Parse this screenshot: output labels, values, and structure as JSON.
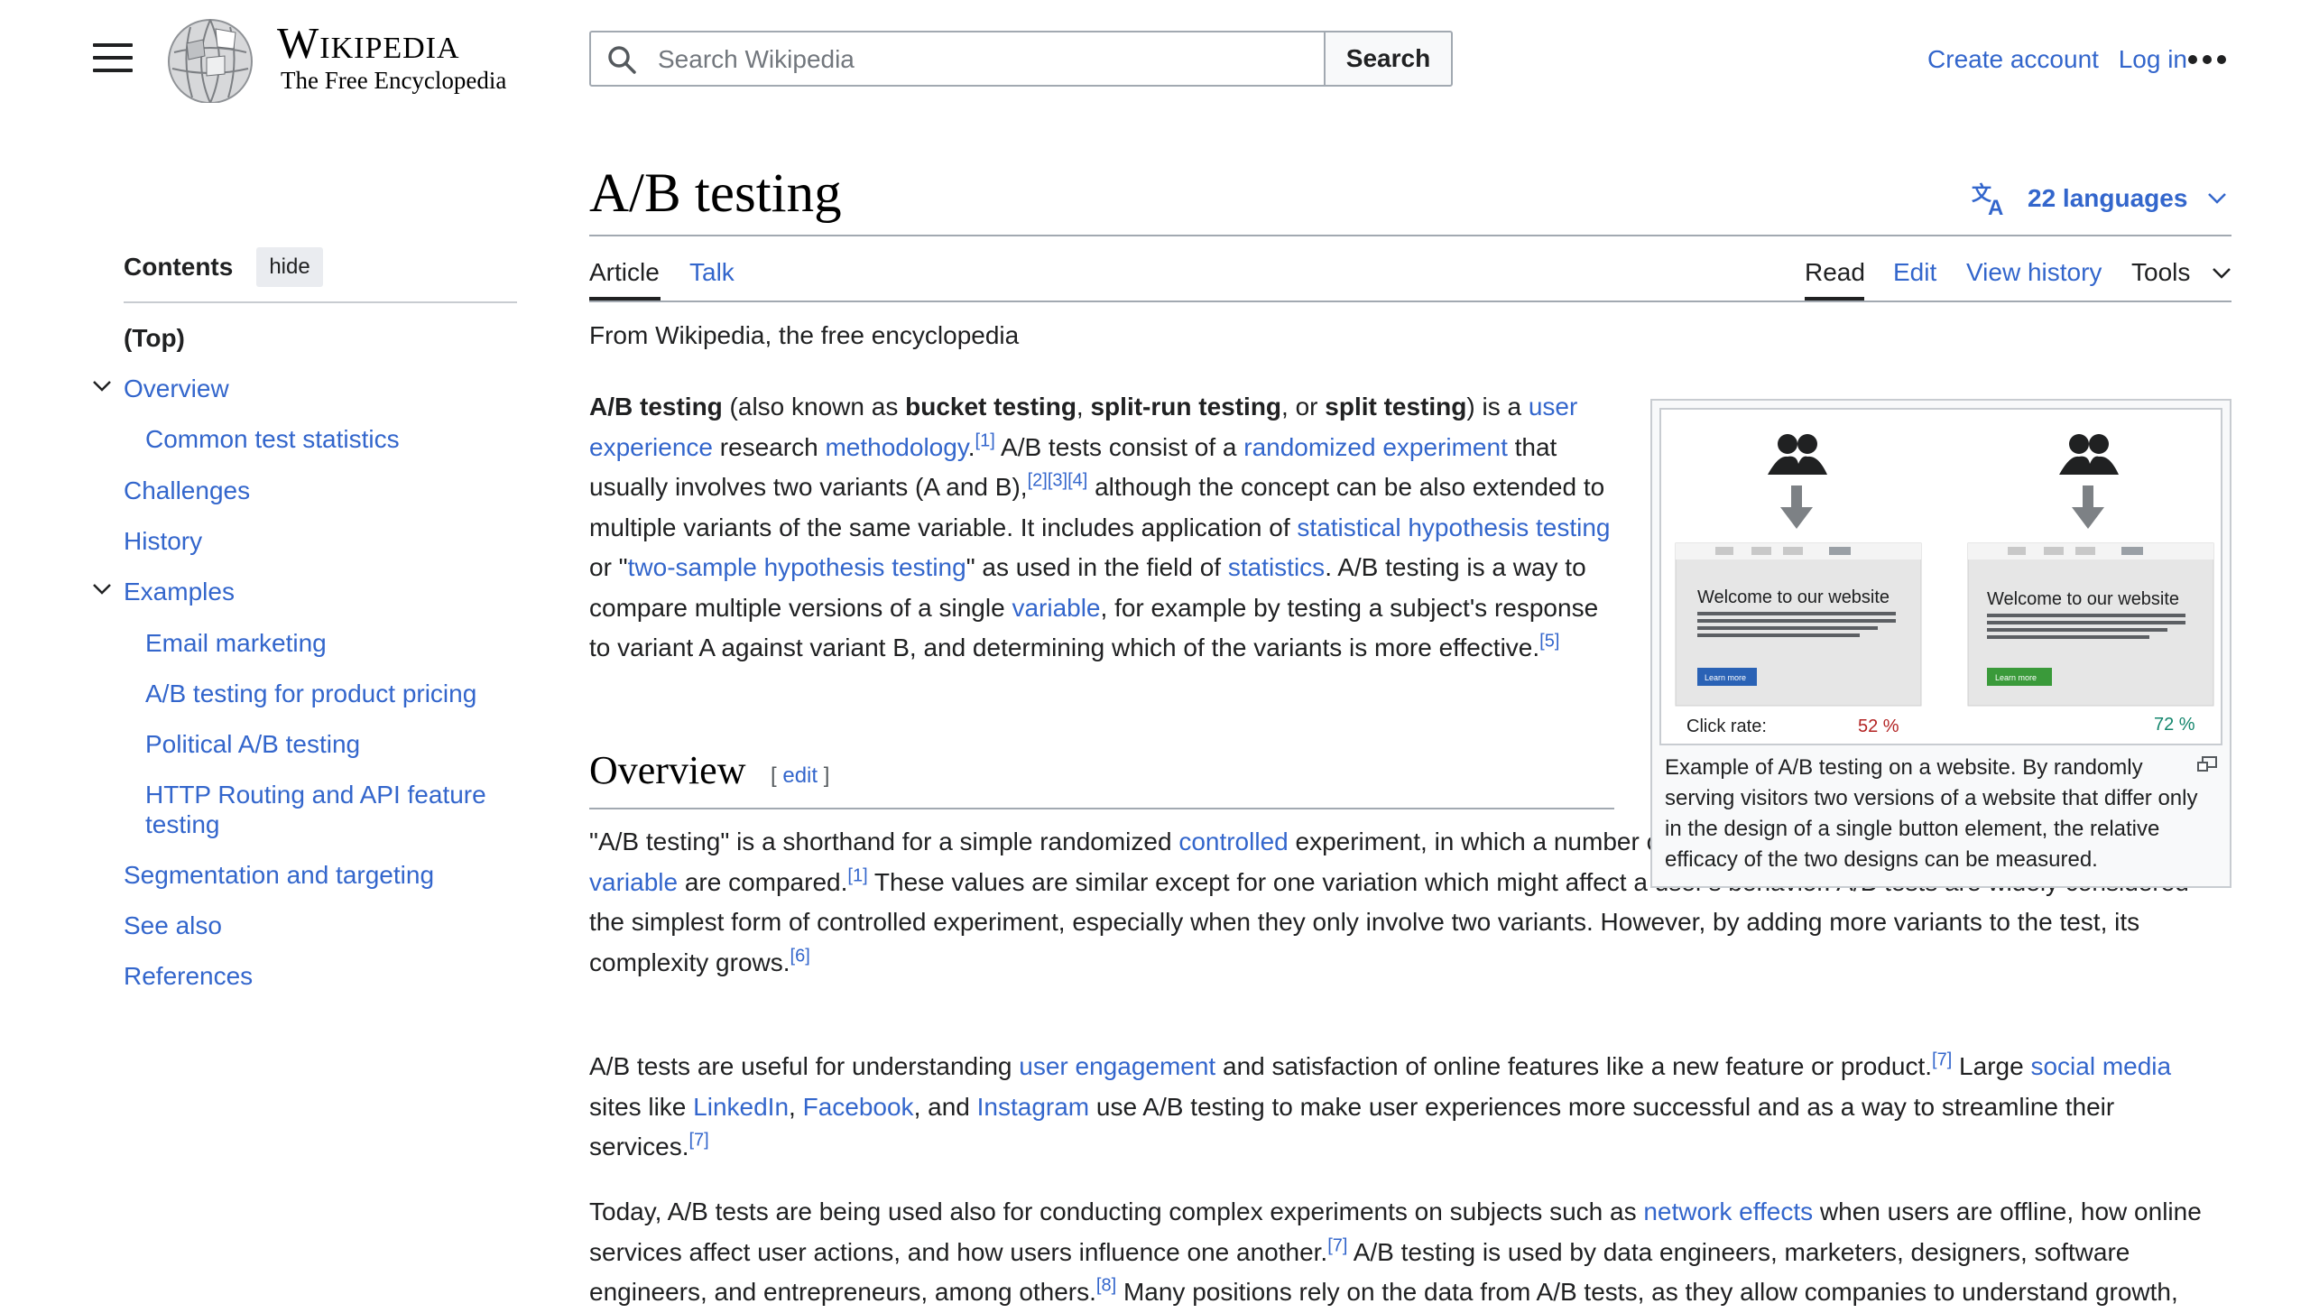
{
  "header": {
    "logo_wordmark": "Wikipedia",
    "logo_tagline": "The Free Encyclopedia",
    "search_placeholder": "Search Wikipedia",
    "search_button": "Search",
    "create_account": "Create account",
    "log_in": "Log in"
  },
  "toc": {
    "title": "Contents",
    "hide_label": "hide",
    "items": [
      {
        "label": "(Top)"
      },
      {
        "label": "Overview"
      },
      {
        "label": "Common test statistics"
      },
      {
        "label": "Challenges"
      },
      {
        "label": "History"
      },
      {
        "label": "Examples"
      },
      {
        "label": "Email marketing"
      },
      {
        "label": "A/B testing for product pricing"
      },
      {
        "label": "Political A/B testing"
      },
      {
        "label": "HTTP Routing and API feature testing"
      },
      {
        "label": "Segmentation and targeting"
      },
      {
        "label": "See also"
      },
      {
        "label": "References"
      }
    ]
  },
  "article": {
    "title": "A/B testing",
    "languages": "22 languages",
    "tabs_left": [
      "Article",
      "Talk"
    ],
    "tabs_right": [
      "Read",
      "Edit",
      "View history",
      "Tools"
    ],
    "tagline": "From Wikipedia, the free encyclopedia",
    "intro": {
      "t1": "A/B testing",
      "t2": " (also known as ",
      "t3": "bucket testing",
      "t4": ", ",
      "t5": "split-run testing",
      "t6": ", or ",
      "t7": "split testing",
      "t8": ") is a ",
      "l1": "user experience",
      "t9": " research ",
      "l2": "methodology",
      "t10": ".",
      "s1": "[1]",
      "t11": " A/B tests consist of a ",
      "l3": "randomized experiment",
      "t12": " that usually involves two variants (A and B),",
      "s2": "[2]",
      "s3": "[3]",
      "s4": "[4]",
      "t13": " although the concept can be also extended to multiple variants of the same variable. It includes application of ",
      "l4": "statistical hypothesis testing",
      "t14": " or \"",
      "l5": "two-sample hypothesis testing",
      "t15": "\" as used in the field of ",
      "l6": "statistics",
      "t16": ". A/B testing is a way to compare multiple versions of a single ",
      "l7": "variable",
      "t17": ", for example by testing a subject's response to variant A against variant B, and determining which of the variants is more effective.",
      "s5": "[5]"
    },
    "overview_heading": "Overview",
    "edit_label": "edit",
    "p2": {
      "t1": "\"A/B testing\" is a shorthand for a simple randomized ",
      "l1": "controlled",
      "t2": " experiment, in which a number of samples (e.g. A and B) of a single ",
      "l2": "vector-variable",
      "t3": " are compared.",
      "s1": "[1]",
      "t4": " These values are similar except for one variation which might affect a user's behavior. A/B tests are widely considered the simplest form of controlled experiment, especially when they only involve two variants. However, by adding more variants to the test, its complexity grows.",
      "s2": "[6]"
    },
    "p3": {
      "t1": "A/B tests are useful for understanding ",
      "l1": "user engagement",
      "t2": " and satisfaction of online features like a new feature or product.",
      "s1": "[7]",
      "t3": " Large ",
      "l2": "social media",
      "t4": " sites like ",
      "l3": "LinkedIn",
      "t5": ", ",
      "l4": "Facebook",
      "t6": ", and ",
      "l5": "Instagram",
      "t7": " use A/B testing to make user experiences more successful and as a way to streamline their services.",
      "s2": "[7]"
    },
    "p4": {
      "t1": "Today, A/B tests are being used also for conducting complex experiments on subjects such as ",
      "l1": "network effects",
      "t2": " when users are offline, how online services affect user actions, and how users influence one another.",
      "s1": "[7]",
      "t3": " A/B testing is used by data engineers, marketers, designers, software engineers, and entrepreneurs, among others.",
      "s2": "[8]",
      "t4": " Many positions rely on the data from A/B tests, as they allow companies to understand growth,"
    }
  },
  "figure": {
    "variant_a": {
      "heading": "Welcome to our website",
      "button": "Learn more",
      "rate": "52 %"
    },
    "variant_b": {
      "heading": "Welcome to our website",
      "button": "Learn more",
      "rate": "72 %"
    },
    "click_rate_label": "Click rate:",
    "caption": "Example of A/B testing on a website. By randomly serving visitors two versions of a website that differ only in the design of a single button element, the relative efficacy of the two designs can be measured."
  },
  "colors": {
    "link": "#3366cc",
    "rate_a": "#b32424",
    "rate_b": "#14866d"
  }
}
